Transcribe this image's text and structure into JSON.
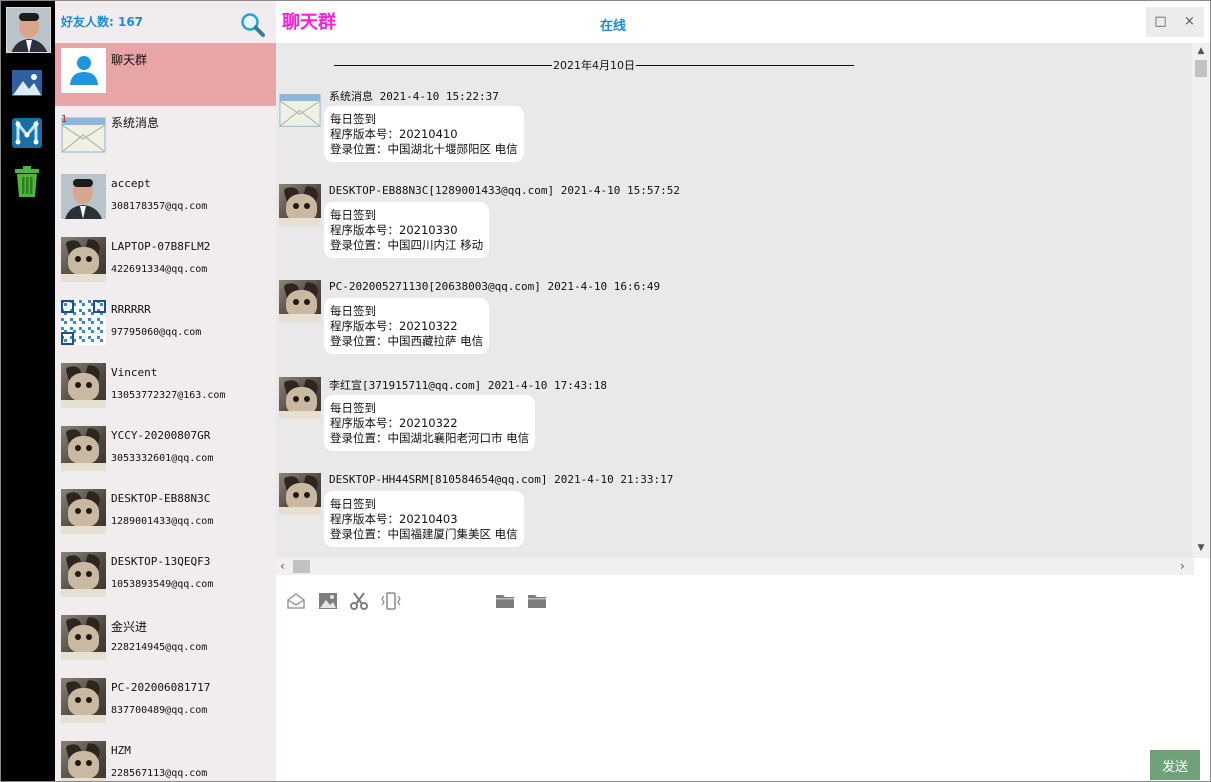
{
  "sidebar": {
    "friend_count_label": "好友人数: 167"
  },
  "header": {
    "title": "聊天群",
    "status": "在线"
  },
  "contacts": [
    {
      "name": "聊天群",
      "email": "",
      "avatar": "group",
      "selected": true
    },
    {
      "name": "系统消息",
      "email": "",
      "avatar": "mail",
      "badge": "1"
    },
    {
      "name": "accept",
      "email": "308178357@qq.com",
      "avatar": "person"
    },
    {
      "name": "LAPTOP-07B8FLM2",
      "email": "422691334@qq.com",
      "avatar": "cat"
    },
    {
      "name": "RRRRRR",
      "email": "97795060@qq.com",
      "avatar": "qr"
    },
    {
      "name": "Vincent",
      "email": "13053772327@163.com",
      "avatar": "cat"
    },
    {
      "name": "YCCY-20200807GR",
      "email": "3053332601@qq.com",
      "avatar": "cat"
    },
    {
      "name": "DESKTOP-EB88N3C",
      "email": "1289001433@qq.com",
      "avatar": "cat"
    },
    {
      "name": "DESKTOP-13QEQF3",
      "email": "1053893549@qq.com",
      "avatar": "cat"
    },
    {
      "name": "金兴进",
      "email": "228214945@qq.com",
      "avatar": "cat"
    },
    {
      "name": "PC-202006081717",
      "email": "837700489@qq.com",
      "avatar": "cat"
    },
    {
      "name": "HZM",
      "email": "228567113@qq.com",
      "avatar": "cat"
    }
  ],
  "chat": {
    "date_separator": "2021年4月10日",
    "messages": [
      {
        "header": "系统消息 2021-4-10 15:22:37",
        "avatar": "mail",
        "lines": [
          "每日签到",
          "程序版本号：20210410",
          "登录位置：中国湖北十堰郧阳区 电信"
        ]
      },
      {
        "header": "DESKTOP-EB88N3C[1289001433@qq.com] 2021-4-10 15:57:52",
        "avatar": "cat",
        "lines": [
          "每日签到",
          "程序版本号：20210330",
          "登录位置：中国四川内江 移动"
        ]
      },
      {
        "header": "PC-202005271130[20638003@qq.com] 2021-4-10 16:6:49",
        "avatar": "cat",
        "lines": [
          "每日签到",
          "程序版本号：20210322",
          "登录位置：中国西藏拉萨 电信"
        ]
      },
      {
        "header": "李红宣[371915711@qq.com] 2021-4-10 17:43:18",
        "avatar": "cat",
        "lines": [
          "每日签到",
          "程序版本号：20210322",
          "登录位置：中国湖北襄阳老河口市 电信"
        ]
      },
      {
        "header": "DESKTOP-HH44SRM[810584654@qq.com] 2021-4-10 21:33:17",
        "avatar": "cat",
        "lines": [
          "每日签到",
          "程序版本号：20210403",
          "登录位置：中国福建厦门集美区 电信"
        ]
      }
    ]
  },
  "compose": {
    "send_label": "发送",
    "tools": [
      "mailbox-icon",
      "image-icon",
      "scissors-icon",
      "vibrate-icon",
      "folder-icon",
      "folder-icon"
    ]
  },
  "window": {
    "maximize_label": "□",
    "close_label": "×"
  },
  "colors": {
    "title_pink": "#ff1fd8",
    "status_blue": "#1f8ad6",
    "selected_row": "#e7a5a8",
    "send_button": "#6fa27a"
  }
}
